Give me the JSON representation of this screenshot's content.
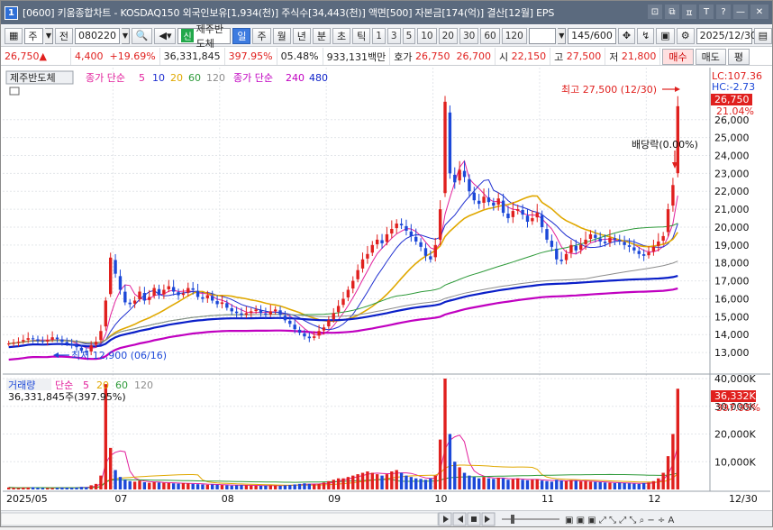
{
  "window": {
    "title": "[0600] 키움종합차트 - KOSDAQ150 외국인보유[1,934(천)] 주식수[34,443(천)] 액면[500] 자본금[174(억)] 결산[12월] EPS",
    "app_icon": "1",
    "controls": [
      "⊡",
      "⧉",
      "ㅍ",
      "T",
      "?",
      "—",
      "✕"
    ]
  },
  "toolbar": {
    "period_type": "주",
    "prev_label": "전",
    "code": "080220",
    "stock_badge": "신",
    "stock_name": "제주반도체",
    "periods": [
      "일",
      "주",
      "월",
      "년",
      "분",
      "초",
      "틱"
    ],
    "active_period": "일",
    "intervals": [
      "1",
      "3",
      "5",
      "10",
      "20",
      "30",
      "60",
      "120"
    ],
    "count": "145/600",
    "date": "2025/12/30"
  },
  "quote": {
    "price": "26,750▲",
    "change": "4,400",
    "change_pct": "+19.69%",
    "volume": "36,331,845",
    "volume_ratio": "397.95%",
    "turnover": "05.48%",
    "amount": "933,131백만",
    "ask_label": "호가",
    "ask": "26,750",
    "bid": "26,700",
    "open_label": "시",
    "open": "22,150",
    "high_label": "고",
    "high": "27,500",
    "low_label": "저",
    "low": "21,800",
    "buy_label": "매수",
    "sell_label": "매도",
    "eval_label": "평"
  },
  "price_pane": {
    "legend_name": "제주반도체",
    "legend_ma_prefix": "종가 단순",
    "legend_ma_periods": [
      "5",
      "10",
      "20",
      "60",
      "120"
    ],
    "legend_ma2_prefix": "종가 단순",
    "legend_ma2_periods": [
      "240",
      "480"
    ],
    "lc": "LC:107.36",
    "hc": "HC:-2.73",
    "current_tag": "26,750",
    "current_pct": "21.04%",
    "high_note": "최고 27,500 (12/30)",
    "low_note": "최저 12,900 (06/16)",
    "dividend_note": "배당락(0.00%)"
  },
  "volume_pane": {
    "legend_name": "거래량",
    "legend_ma_prefix": "단순",
    "legend_ma_periods": [
      "5",
      "20",
      "60",
      "120"
    ],
    "value_label": "36,331,845주(397.95%)",
    "current_tag": "36,332K",
    "current_pct": "397.95%"
  },
  "date_axis": {
    "start_label": "2025/05",
    "end_label": "12/30",
    "month_labels": [
      "07",
      "08",
      "09",
      "10",
      "11",
      "12"
    ]
  },
  "colors": {
    "up": "#e0201e",
    "down": "#1c48d8",
    "ma5": "#e2209c",
    "ma10": "#1f2fd0",
    "ma20": "#e0a800",
    "ma60": "#2e9a3a",
    "ma120": "#8d8d8d",
    "ma240": "#c000c0",
    "ma480": "#0a1fc8"
  },
  "chart_data": {
    "type": "candlestick",
    "title": "제주반도체",
    "y_ticks": [
      13000,
      14000,
      15000,
      16000,
      17000,
      18000,
      19000,
      20000,
      21000,
      22000,
      23000,
      24000,
      25000,
      26000
    ],
    "ylim": [
      12300,
      27900
    ],
    "vol_ticks_label": [
      "10,000K",
      "20,000K",
      "30,000K",
      "40,000K"
    ],
    "vol_ticks": [
      10000,
      20000,
      30000,
      40000
    ],
    "vol_ylim": [
      0,
      40000
    ],
    "closes": [
      13500,
      13550,
      13600,
      13700,
      13800,
      13750,
      13650,
      13600,
      13700,
      13850,
      13750,
      13600,
      13500,
      13400,
      13300,
      13100,
      13000,
      13400,
      13600,
      14200,
      15900,
      18300,
      17400,
      16500,
      15800,
      15700,
      15900,
      16400,
      15900,
      16100,
      16600,
      16200,
      16500,
      16700,
      16400,
      16200,
      16300,
      16600,
      16500,
      16100,
      16000,
      16200,
      15900,
      15700,
      15800,
      15500,
      15300,
      15200,
      15100,
      15200,
      15300,
      15400,
      15200,
      15100,
      15300,
      15400,
      15100,
      14800,
      14600,
      14300,
      14100,
      13900,
      13800,
      13900,
      14200,
      14400,
      14800,
      15200,
      15600,
      16000,
      16500,
      17000,
      17600,
      18200,
      18500,
      19000,
      19300,
      19100,
      19600,
      19900,
      20200,
      20100,
      19800,
      19500,
      19200,
      18900,
      18400,
      18200,
      19000,
      21000,
      27000,
      23000,
      22500,
      23200,
      22800,
      22000,
      21500,
      21300,
      21700,
      21400,
      21200,
      21600,
      20800,
      20500,
      20900,
      21000,
      20700,
      20300,
      20500,
      20800,
      20000,
      19300,
      18900,
      18200,
      18100,
      18500,
      19000,
      18700,
      19000,
      19300,
      19600,
      19400,
      19200,
      19100,
      19400,
      19300,
      19200,
      19000,
      18900,
      18700,
      18500,
      18400,
      18600,
      18900,
      19200,
      19500,
      21000,
      22350,
      26750
    ],
    "volumes": [
      700,
      600,
      500,
      650,
      700,
      800,
      600,
      550,
      500,
      500,
      600,
      700,
      650,
      600,
      700,
      900,
      800,
      1500,
      2000,
      5000,
      38000,
      15000,
      7000,
      4500,
      3500,
      3000,
      2800,
      3200,
      2600,
      2400,
      2600,
      2500,
      2400,
      2300,
      2200,
      2100,
      2300,
      2200,
      2000,
      1900,
      1800,
      1700,
      1800,
      1700,
      1600,
      1500,
      1400,
      1500,
      1600,
      1500,
      1400,
      1300,
      1300,
      1400,
      1500,
      1400,
      1300,
      1500,
      1600,
      1800,
      2000,
      2200,
      2000,
      1800,
      2000,
      2500,
      3000,
      3500,
      4000,
      4000,
      4500,
      5000,
      5500,
      6000,
      6500,
      6000,
      5500,
      5000,
      5500,
      6500,
      7000,
      6000,
      5000,
      4500,
      4000,
      3800,
      3500,
      4000,
      5000,
      18000,
      42000,
      20000,
      10000,
      8000,
      6000,
      5000,
      4500,
      4000,
      4500,
      4000,
      3800,
      4200,
      4000,
      3500,
      3700,
      4000,
      3500,
      3300,
      3500,
      3700,
      3200,
      3000,
      2800,
      3500,
      3200,
      3000,
      3300,
      3100,
      2900,
      3000,
      2800,
      2700,
      2600,
      2500,
      2400,
      2300,
      2400,
      2300,
      2200,
      2100,
      2000,
      2300,
      2500,
      3000,
      4000,
      6000,
      12000,
      20000,
      36332
    ]
  }
}
